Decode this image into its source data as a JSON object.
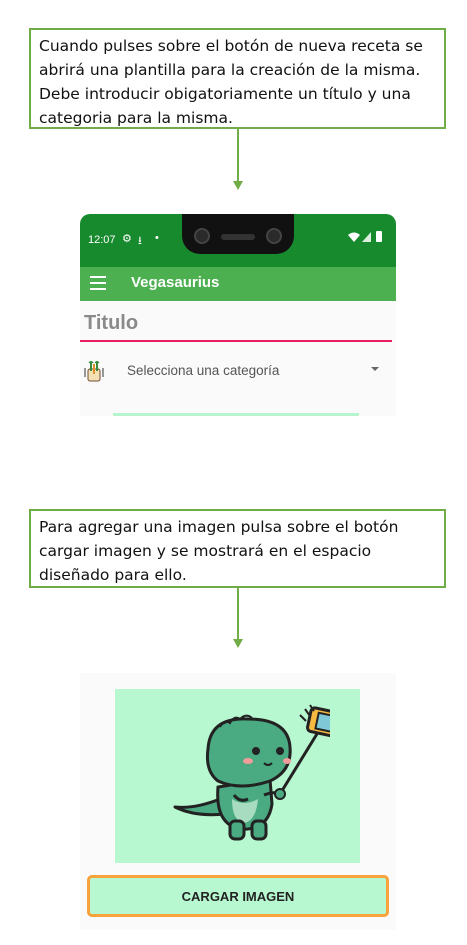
{
  "callouts": {
    "first": "Cuando pulses sobre el botón de nueva receta se abrirá una plantilla para la creación de la misma. Debe introducir obigatoriamente un título y una categoria para la misma.",
    "second": "Para agregar una imagen pulsa sobre el botón cargar imagen y se mostrará en el espacio diseñado para ello."
  },
  "status_bar": {
    "time": "12:07"
  },
  "app_bar": {
    "title": "Vegasaurius",
    "menu_icon": "hamburger-icon"
  },
  "form": {
    "title_placeholder": "Titulo",
    "category_placeholder": "Selecciona una categoría",
    "category_icon": "vegetables-icon"
  },
  "image_panel": {
    "button_label": "CARGAR IMAGEN",
    "image_icon": "dinosaur-selfie-illustration"
  },
  "colors": {
    "callout_border": "#70ad47",
    "status_bar": "#188a2e",
    "app_bar": "#4caf50",
    "title_underline": "#e91e63",
    "mint": "#b7f8d0",
    "button_border": "#f5a33a"
  }
}
